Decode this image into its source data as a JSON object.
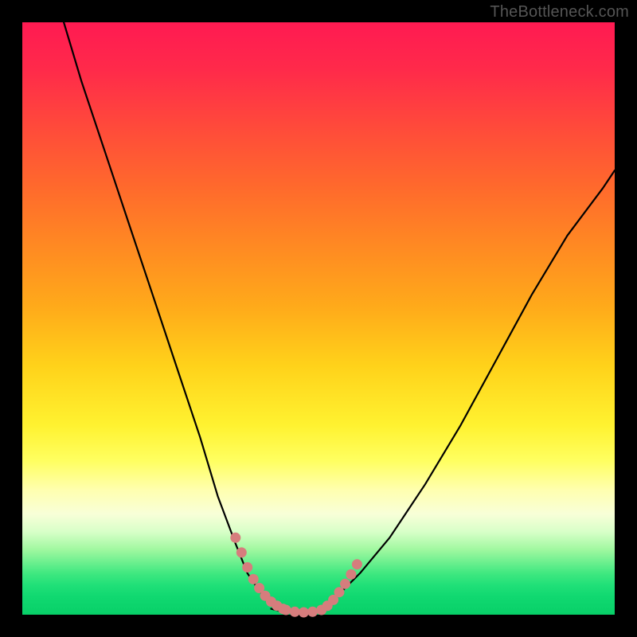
{
  "watermark": "TheBottleneck.com",
  "chart_data": {
    "type": "line",
    "title": "",
    "xlabel": "",
    "ylabel": "",
    "xlim": [
      0,
      100
    ],
    "ylim": [
      0,
      100
    ],
    "series": [
      {
        "name": "left-curve",
        "x": [
          7,
          10,
          14,
          18,
          22,
          26,
          30,
          33,
          36,
          38,
          40,
          42,
          44
        ],
        "y": [
          100,
          90,
          78,
          66,
          54,
          42,
          30,
          20,
          12,
          7,
          4,
          2,
          1
        ]
      },
      {
        "name": "right-curve",
        "x": [
          50,
          53,
          57,
          62,
          68,
          74,
          80,
          86,
          92,
          98,
          100
        ],
        "y": [
          1,
          3,
          7,
          13,
          22,
          32,
          43,
          54,
          64,
          72,
          75
        ]
      },
      {
        "name": "bottom-flat",
        "x": [
          42,
          44,
          46,
          48,
          50,
          52
        ],
        "y": [
          1,
          0.5,
          0.3,
          0.3,
          0.5,
          1
        ]
      }
    ],
    "markers": [
      {
        "name": "left-dots",
        "color": "#d67d7d",
        "points": [
          {
            "x": 36.0,
            "y": 13.0
          },
          {
            "x": 37.0,
            "y": 10.5
          },
          {
            "x": 38.0,
            "y": 8.0
          },
          {
            "x": 39.0,
            "y": 6.0
          },
          {
            "x": 40.0,
            "y": 4.5
          },
          {
            "x": 41.0,
            "y": 3.2
          },
          {
            "x": 42.0,
            "y": 2.2
          },
          {
            "x": 43.0,
            "y": 1.5
          },
          {
            "x": 44.0,
            "y": 1.0
          }
        ]
      },
      {
        "name": "bottom-dots",
        "color": "#d67d7d",
        "points": [
          {
            "x": 44.5,
            "y": 0.8
          },
          {
            "x": 46.0,
            "y": 0.5
          },
          {
            "x": 47.5,
            "y": 0.4
          },
          {
            "x": 49.0,
            "y": 0.5
          },
          {
            "x": 50.5,
            "y": 0.8
          }
        ]
      },
      {
        "name": "right-dots",
        "color": "#d67d7d",
        "points": [
          {
            "x": 51.5,
            "y": 1.5
          },
          {
            "x": 52.5,
            "y": 2.5
          },
          {
            "x": 53.5,
            "y": 3.8
          },
          {
            "x": 54.5,
            "y": 5.2
          },
          {
            "x": 55.5,
            "y": 6.8
          },
          {
            "x": 56.5,
            "y": 8.5
          }
        ]
      }
    ],
    "gradient_stops": [
      {
        "pos": 0,
        "color": "#ff1a52"
      },
      {
        "pos": 50,
        "color": "#ffd21a"
      },
      {
        "pos": 80,
        "color": "#ffffb0"
      },
      {
        "pos": 100,
        "color": "#08d068"
      }
    ]
  }
}
